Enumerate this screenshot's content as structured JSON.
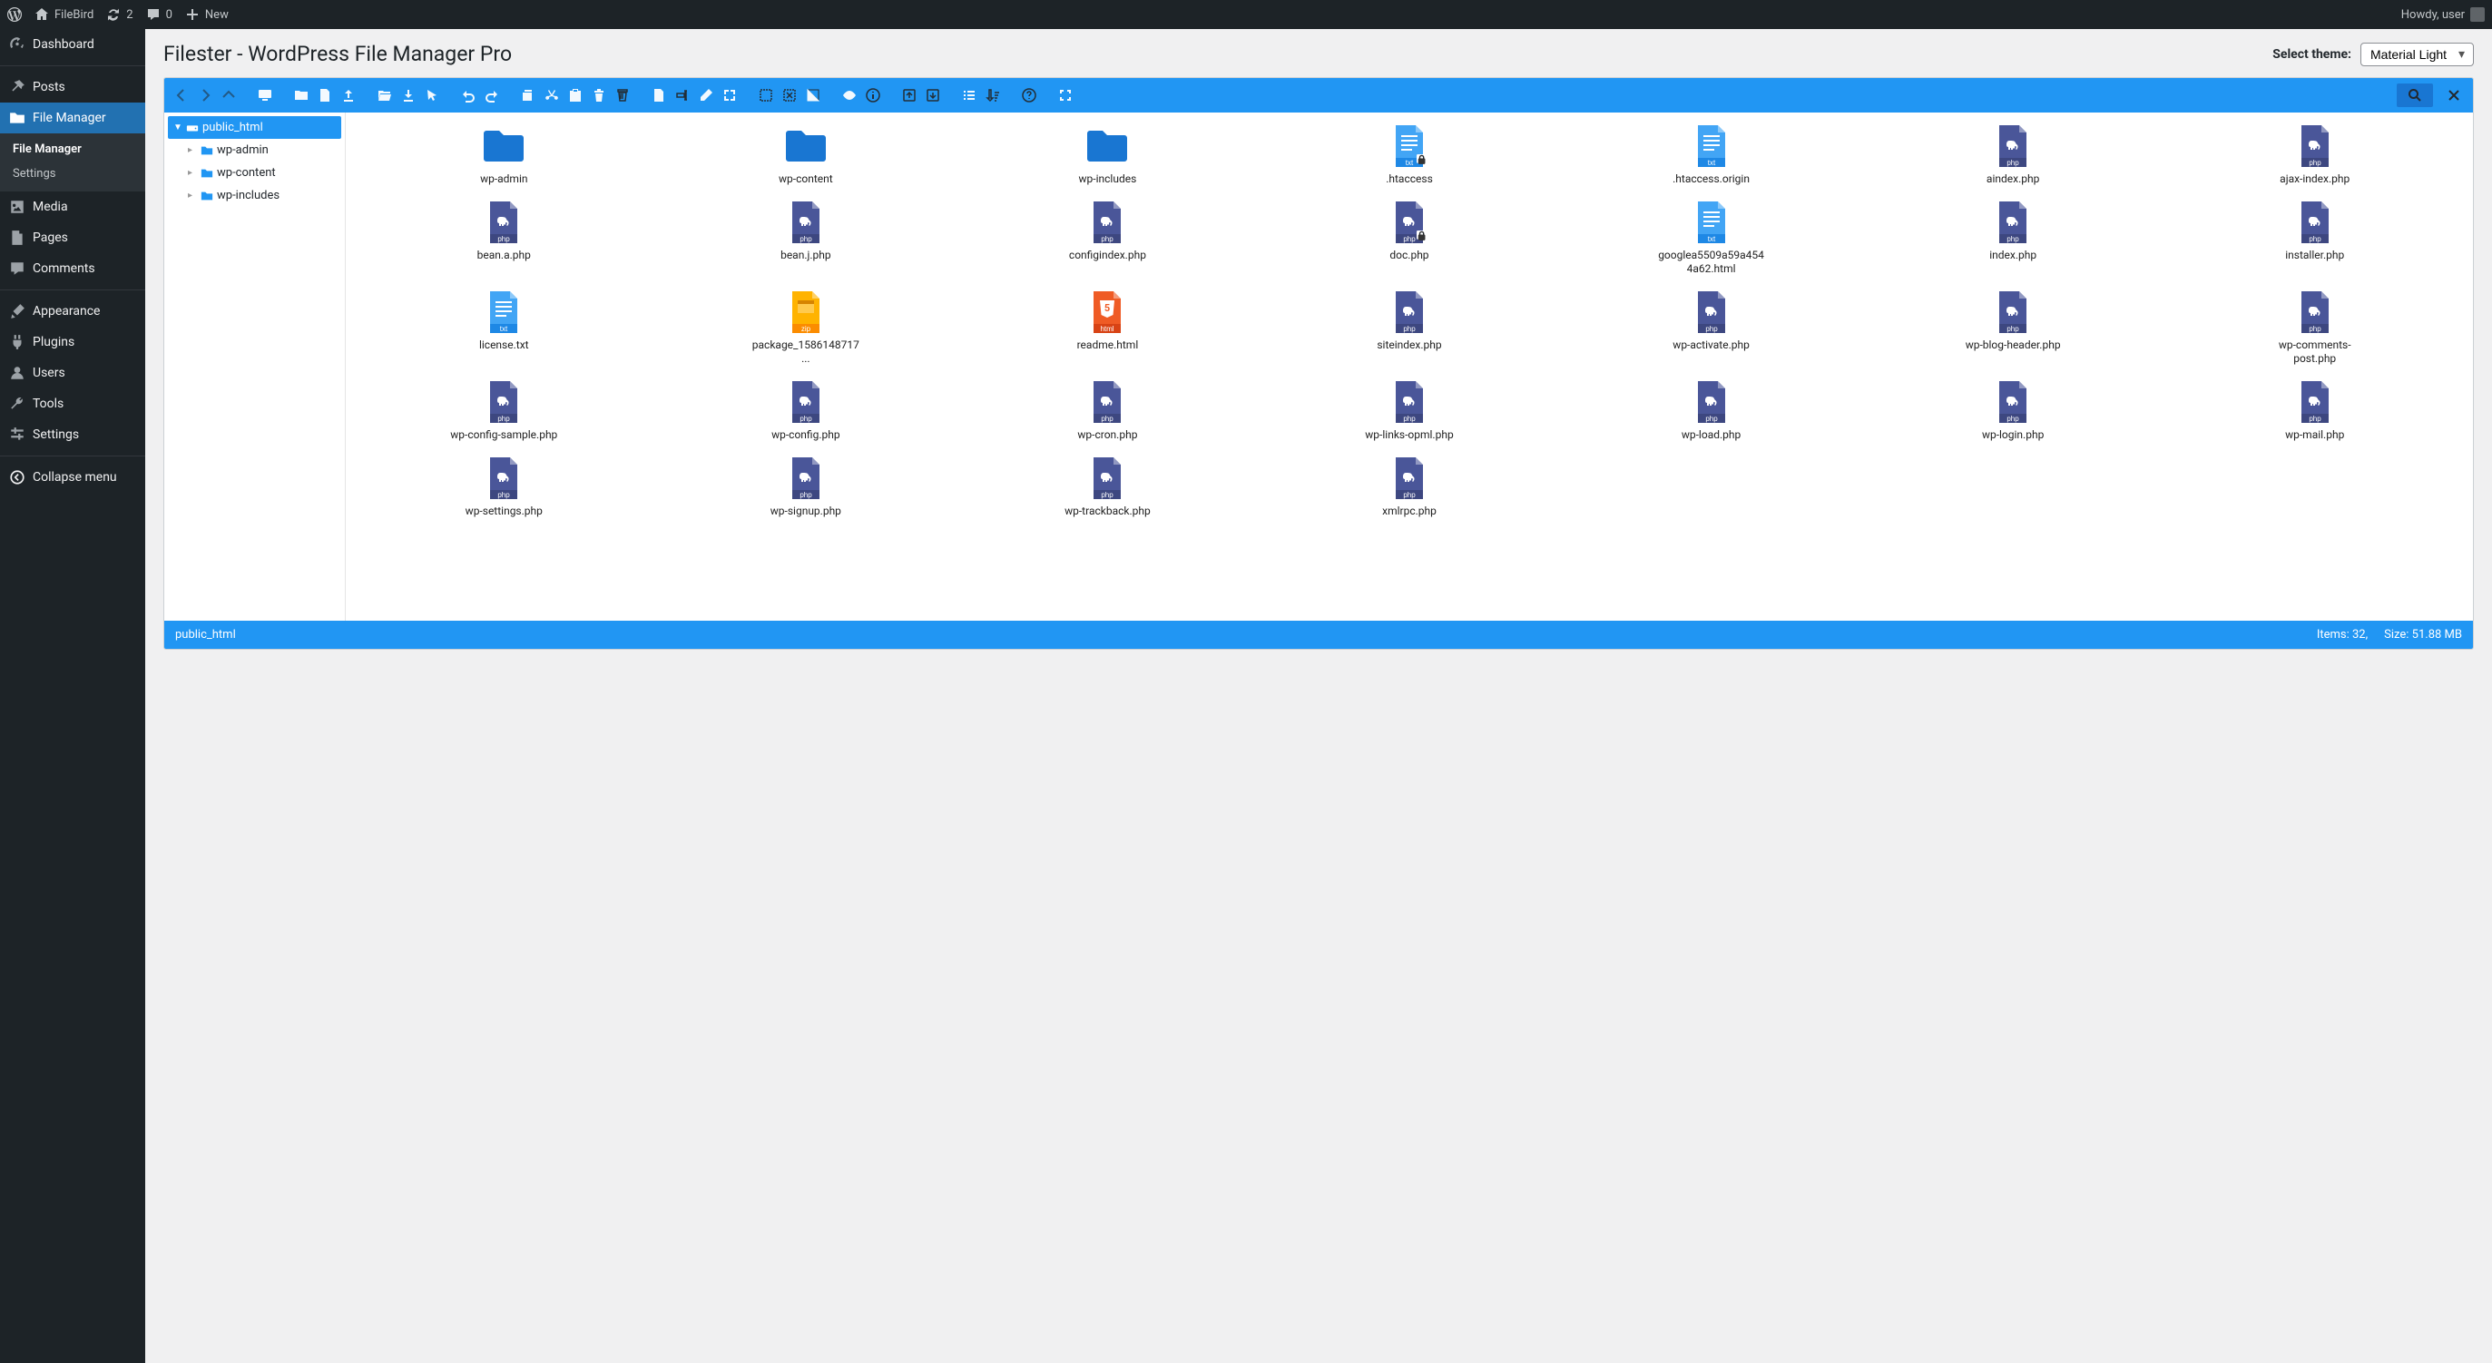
{
  "adminBar": {
    "siteName": "FileBird",
    "updateCount": "2",
    "commentCount": "0",
    "newLabel": "New",
    "greeting": "Howdy, user"
  },
  "sidebar": {
    "dashboard": "Dashboard",
    "posts": "Posts",
    "fileManager": "File Manager",
    "sub_fileManager": "File Manager",
    "sub_settings": "Settings",
    "media": "Media",
    "pages": "Pages",
    "comments": "Comments",
    "appearance": "Appearance",
    "plugins": "Plugins",
    "users": "Users",
    "tools": "Tools",
    "settings": "Settings",
    "collapse": "Collapse menu"
  },
  "page": {
    "title": "Filester - WordPress File Manager Pro",
    "themeLabel": "Select theme:",
    "themeValue": "Material Light"
  },
  "tree": {
    "root": "public_html",
    "children": [
      "wp-admin",
      "wp-content",
      "wp-includes"
    ]
  },
  "files": [
    {
      "name": "wp-admin",
      "type": "folder"
    },
    {
      "name": "wp-content",
      "type": "folder"
    },
    {
      "name": "wp-includes",
      "type": "folder"
    },
    {
      "name": ".htaccess",
      "type": "txt",
      "locked": true
    },
    {
      "name": ".htaccess.origin",
      "type": "txt"
    },
    {
      "name": "aindex.php",
      "type": "php"
    },
    {
      "name": "ajax-index.php",
      "type": "php"
    },
    {
      "name": "bean.a.php",
      "type": "php"
    },
    {
      "name": "bean.j.php",
      "type": "php"
    },
    {
      "name": "configindex.php",
      "type": "php"
    },
    {
      "name": "doc.php",
      "type": "php",
      "locked": true
    },
    {
      "name": "googlea5509a59a4544a62.html",
      "type": "txt"
    },
    {
      "name": "index.php",
      "type": "php"
    },
    {
      "name": "installer.php",
      "type": "php"
    },
    {
      "name": "license.txt",
      "type": "txt"
    },
    {
      "name": "package_1586148717...",
      "type": "zip"
    },
    {
      "name": "readme.html",
      "type": "html"
    },
    {
      "name": "siteindex.php",
      "type": "php"
    },
    {
      "name": "wp-activate.php",
      "type": "php"
    },
    {
      "name": "wp-blog-header.php",
      "type": "php"
    },
    {
      "name": "wp-comments-post.php",
      "type": "php"
    },
    {
      "name": "wp-config-sample.php",
      "type": "php"
    },
    {
      "name": "wp-config.php",
      "type": "php"
    },
    {
      "name": "wp-cron.php",
      "type": "php"
    },
    {
      "name": "wp-links-opml.php",
      "type": "php"
    },
    {
      "name": "wp-load.php",
      "type": "php"
    },
    {
      "name": "wp-login.php",
      "type": "php"
    },
    {
      "name": "wp-mail.php",
      "type": "php"
    },
    {
      "name": "wp-settings.php",
      "type": "php"
    },
    {
      "name": "wp-signup.php",
      "type": "php"
    },
    {
      "name": "wp-trackback.php",
      "type": "php"
    },
    {
      "name": "xmlrpc.php",
      "type": "php"
    }
  ],
  "status": {
    "path": "public_html",
    "items": "Items: 32,",
    "size": "Size: 51.88 MB"
  },
  "icons": {
    "php_badge": "php",
    "txt_badge": "txt",
    "zip_badge": "zip",
    "html_badge": "html"
  }
}
